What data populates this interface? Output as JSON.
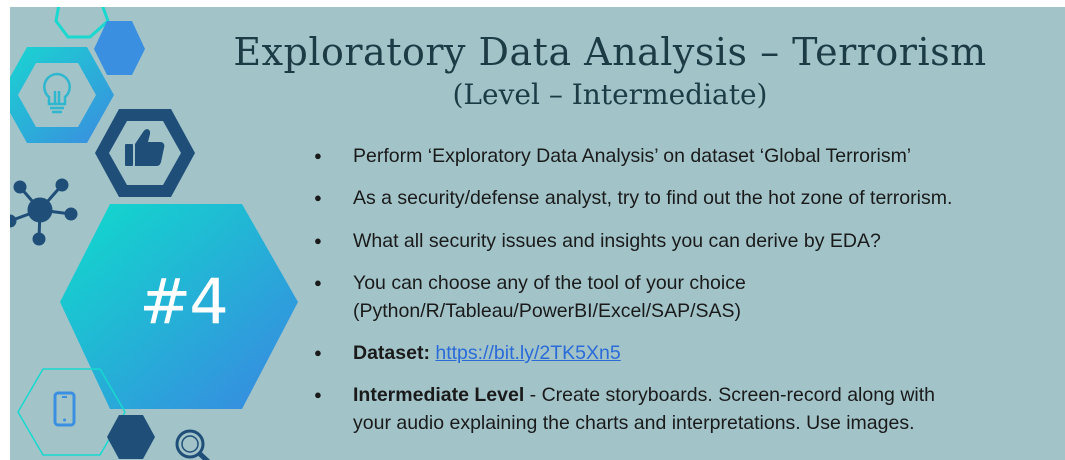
{
  "slide": {
    "title": "Exploratory Data Analysis – Terrorism",
    "subtitle": "(Level – Intermediate)",
    "task_number": "#4",
    "bullets": [
      {
        "text": "Perform ‘Exploratory Data Analysis’ on dataset  ‘Global Terrorism’"
      },
      {
        "text": "As a security/defense analyst, try to find out the hot zone of terrorism."
      },
      {
        "text": "What all security issues and insights you can derive by EDA?"
      },
      {
        "line1": "You can choose any of the tool of your choice",
        "line2": "(Python/R/Tableau/PowerBI/Excel/SAP/SAS)"
      },
      {
        "label": "Dataset:",
        "link": "https://bit.ly/2TK5Xn5"
      },
      {
        "label": "Intermediate Level",
        "line1": " - Create storyboards. Screen-record along with",
        "line2": "your audio explaining the charts and interpretations. Use images."
      }
    ]
  },
  "icons": [
    "lightbulb-icon",
    "thumbs-up-icon",
    "network-icon",
    "smartphone-icon",
    "magnifier-icon"
  ],
  "colors": {
    "background": "#a2c4c9",
    "title": "#1d3b45",
    "teal": "#15d2cd",
    "blue": "#3a8fe0",
    "navy": "#1f4e79",
    "link": "#2a6bd8"
  }
}
